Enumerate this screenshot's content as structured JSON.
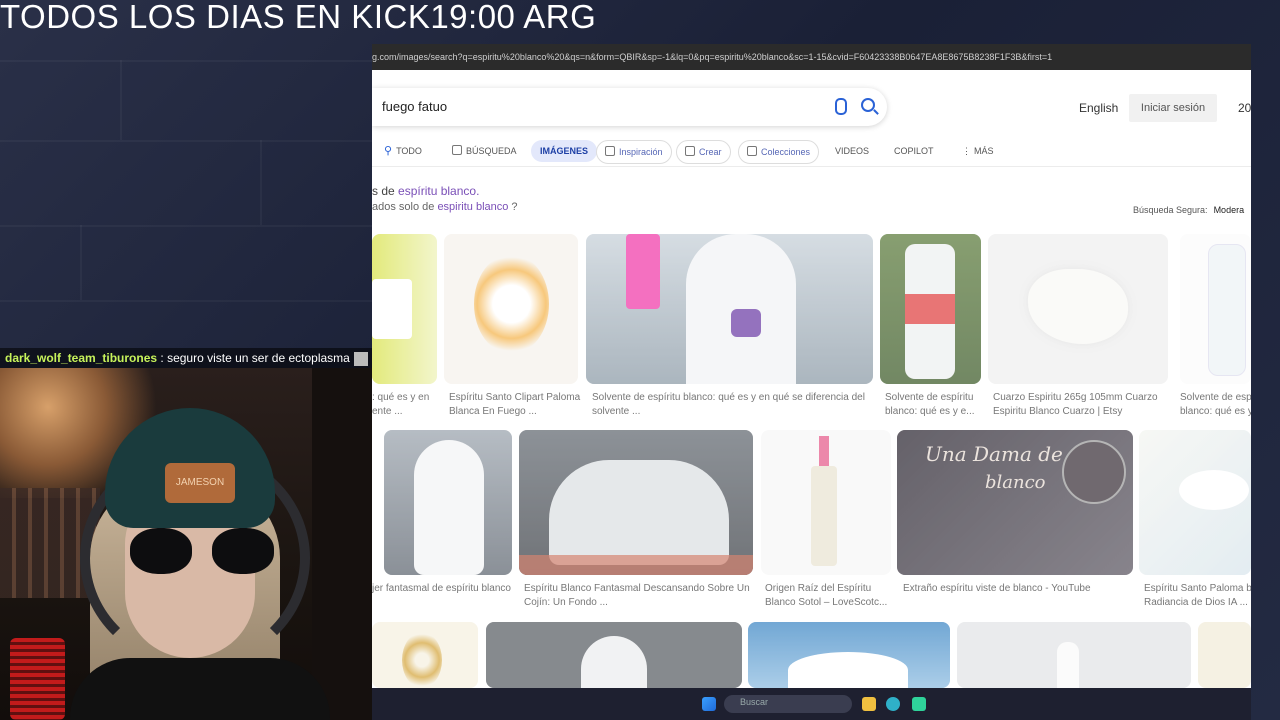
{
  "overlay": {
    "title": "TODOS LOS DIAS EN KICK19:00 ARG"
  },
  "chat": {
    "username": "dark_wolf_team_tiburones",
    "separator": " : ",
    "message": "seguro viste un ser de ectoplasma"
  },
  "webcam": {
    "patch_text": "JAMESON"
  },
  "browser": {
    "url": "g.com/images/search?q=espiritu%20blanco%20&qs=n&form=QBIR&sp=-1&lq=0&pq=espiritu%20blanco&sc=1-15&cvid=F60423338B0647EA8E8675B8238F1F3B&first=1",
    "search_query": "fuego fatuo",
    "lang": "English",
    "login": "Iniciar sesión",
    "counter": "20",
    "tabs": [
      {
        "label": "TODO"
      },
      {
        "label": "BÚSQUEDA"
      },
      {
        "label": "IMÁGENES"
      },
      {
        "label": "Inspiración"
      },
      {
        "label": "Crear"
      },
      {
        "label": "Colecciones"
      },
      {
        "label": "VIDEOS"
      },
      {
        "label": "COPILOT"
      },
      {
        "label": "MÁS"
      }
    ],
    "safe_search_label": "Búsqueda Segura:",
    "safe_search_value": "Modera",
    "suggestion_line1_prefix": "s de ",
    "suggestion_line1_link": "espíritu blanco.",
    "suggestion_line2_prefix": "ados solo de ",
    "suggestion_line2_link": "espiritu blanco",
    "suggestion_line2_suffix": " ?",
    "captions": [
      ": qué es y en\nente ...",
      "Espíritu Santo Clipart Paloma\nBlanca En Fuego ...",
      "Solvente de espíritu blanco: qué es y en qué se diferencia del\nsolvente ...",
      "Solvente de espíritu\nblanco: qué es y e...",
      "Cuarzo Espiritu 265g 105mm Cuarzo\nEspiritu Blanco Cuarzo | Etsy",
      "Solvente de espi\nblanco: qué es y",
      "jer fantasmal de espíritu blanco",
      "Espíritu Blanco Fantasmal Descansando Sobre Un\nCojín: Un Fondo ...",
      "Origen Raíz del Espíritu\nBlanco Sotol – LoveScotc...",
      "Extraño espíritu viste de blanco - YouTube",
      "Espíritu Santo Paloma bl\nRadiancia de Dios IA ..."
    ],
    "thumb_texts": {
      "dama_title": "Una Dama de",
      "dama_sub": "blanco"
    }
  },
  "taskbar": {
    "search_placeholder": "Buscar"
  }
}
